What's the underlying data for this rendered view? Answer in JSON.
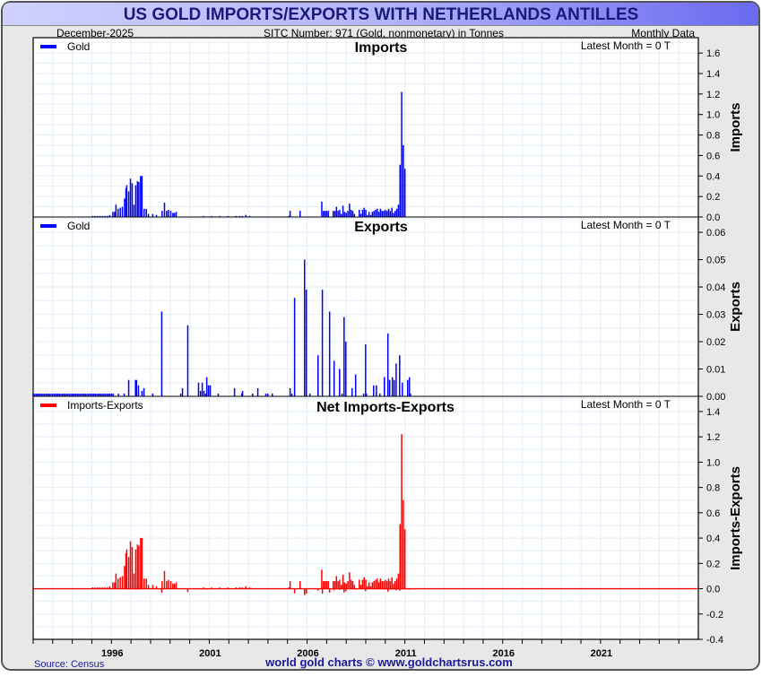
{
  "header": {
    "title": "US GOLD IMPORTS/EXPORTS WITH NETHERLANDS ANTILLES",
    "date": "December-2025",
    "subtitle": "SITC Number: 971 (Gold, nonmonetary) in Tonnes",
    "frequency": "Monthly Data"
  },
  "footer": {
    "source": "Source: Census",
    "credit": "world gold charts © www.goldchartsrus.com"
  },
  "colors": {
    "imports": "#0000ff",
    "exports": "#0000ff",
    "net": "#ff0000",
    "title_text": "#1a1a7a",
    "grid": "#e3eef8"
  },
  "chart_data": [
    {
      "type": "bar",
      "title": "Imports",
      "ylabel": "Imports",
      "legend": "Gold",
      "latest": "Latest Month = 0 T",
      "xlim": [
        1992,
        2026
      ],
      "ylim": [
        0,
        1.75
      ],
      "yticks": [
        "0.0",
        "0.2",
        "0.4",
        "0.6",
        "0.8",
        "1.0",
        "1.2",
        "1.4",
        "1.6"
      ],
      "points": [
        [
          1995.04,
          0.01
        ],
        [
          1995.16,
          0.01
        ],
        [
          1995.29,
          0.01
        ],
        [
          1995.41,
          0.01
        ],
        [
          1995.54,
          0.01
        ],
        [
          1995.66,
          0.01
        ],
        [
          1995.79,
          0.01
        ],
        [
          1995.91,
          0.02
        ],
        [
          1996.07,
          0.05
        ],
        [
          1996.16,
          0.05
        ],
        [
          1996.23,
          0.12
        ],
        [
          1996.34,
          0.08
        ],
        [
          1996.45,
          0.09
        ],
        [
          1996.56,
          0.1
        ],
        [
          1996.67,
          0.18
        ],
        [
          1996.74,
          0.28
        ],
        [
          1996.78,
          0.31
        ],
        [
          1996.88,
          0.25
        ],
        [
          1996.97,
          0.375
        ],
        [
          1997.06,
          0.33
        ],
        [
          1997.15,
          0.12
        ],
        [
          1997.24,
          0.31
        ],
        [
          1997.33,
          0.35
        ],
        [
          1997.4,
          0.34
        ],
        [
          1997.49,
          0.4
        ],
        [
          1997.56,
          0.4
        ],
        [
          1997.67,
          0.08
        ],
        [
          1997.78,
          0.08
        ],
        [
          1997.89,
          0.03
        ],
        [
          1998.11,
          0.03
        ],
        [
          1998.3,
          0.02
        ],
        [
          1998.59,
          0.06
        ],
        [
          1998.71,
          0.14
        ],
        [
          1998.82,
          0.06
        ],
        [
          1998.91,
          0.07
        ],
        [
          1999.03,
          0.06
        ],
        [
          1999.14,
          0.04
        ],
        [
          1999.22,
          0.04
        ],
        [
          1999.31,
          0.05
        ],
        [
          2000.72,
          0.01
        ],
        [
          2001.13,
          0.01
        ],
        [
          2001.54,
          0.01
        ],
        [
          2001.96,
          0.01
        ],
        [
          2002.37,
          0.01
        ],
        [
          2002.56,
          0.01
        ],
        [
          2002.69,
          0.01
        ],
        [
          2002.87,
          0.02
        ],
        [
          2003.06,
          0.01
        ],
        [
          2005.06,
          0.01
        ],
        [
          2005.13,
          0.06
        ],
        [
          2005.64,
          0.06
        ]
      ],
      "monthly_block": {
        "start": 2006.75,
        "values": [
          0.15,
          0.06,
          0.06,
          0.06,
          0.06,
          0,
          0,
          0.06,
          0.06,
          0.1,
          0.06,
          0.07,
          0.03,
          0.11,
          0.05,
          0.04,
          0.06,
          0.13,
          0.07,
          0.06,
          0.03,
          0,
          0,
          0.07,
          0.03,
          0.07,
          0.09,
          0.07,
          0.02,
          0.05,
          0.02,
          0.05,
          0.06,
          0.07,
          0.08,
          0.05,
          0.08,
          0.06,
          0.06,
          0.07,
          0.06,
          0.08,
          0.06,
          0.09,
          0.04,
          0.06,
          0.08,
          0.12,
          0.51,
          1.22,
          0.7,
          0.47
        ]
      }
    },
    {
      "type": "bar",
      "title": "Exports",
      "ylabel": "Exports",
      "legend": "Gold",
      "latest": "Latest Month = 0 T",
      "xlim": [
        1992,
        2026
      ],
      "ylim": [
        0,
        0.0656
      ],
      "yticks": [
        "0.00",
        "0.01",
        "0.02",
        "0.03",
        "0.04",
        "0.05",
        "0.06"
      ],
      "points": [
        [
          1996.36,
          0.001
        ],
        [
          1996.65,
          0.001
        ],
        [
          1996.88,
          0.006
        ],
        [
          1997.23,
          0.006
        ],
        [
          1997.28,
          0.006
        ],
        [
          1997.38,
          0.004
        ],
        [
          1997.56,
          0.002
        ],
        [
          1997.66,
          0.003
        ],
        [
          1998.11,
          0.001
        ],
        [
          1998.57,
          0.031
        ],
        [
          1999.54,
          0.001
        ],
        [
          1999.63,
          0.003
        ],
        [
          1999.9,
          0.026
        ],
        [
          2000.45,
          0.005
        ],
        [
          2000.55,
          0.002
        ],
        [
          2000.64,
          0.005
        ],
        [
          2000.73,
          0.002
        ],
        [
          2000.82,
          0.001
        ],
        [
          2000.87,
          0.007
        ],
        [
          2000.96,
          0.004
        ],
        [
          2001.05,
          0.004
        ],
        [
          2001.46,
          0.001
        ],
        [
          2002.29,
          0.003
        ],
        [
          2002.66,
          0.001
        ],
        [
          2002.7,
          0.002
        ],
        [
          2003.21,
          0.001
        ],
        [
          2003.48,
          0.003
        ],
        [
          2003.89,
          0.001
        ],
        [
          2003.99,
          0.001
        ],
        [
          2004.22,
          0.001
        ],
        [
          2005.13,
          0.003
        ],
        [
          2005.22,
          0.001
        ],
        [
          2005.36,
          0.036
        ],
        [
          2005.87,
          0.05
        ],
        [
          2005.96,
          0.039
        ],
        [
          2006.14,
          0.001
        ],
        [
          2006.56,
          0.015
        ],
        [
          2006.78,
          0.039
        ],
        [
          2007.15,
          0.031
        ],
        [
          2007.38,
          0.013
        ],
        [
          2007.66,
          0.01
        ],
        [
          2007.79,
          0.001
        ],
        [
          2007.89,
          0.029
        ],
        [
          2007.98,
          0.02
        ],
        [
          2008.3,
          0.003
        ],
        [
          2008.48,
          0.008
        ],
        [
          2008.89,
          0.001
        ],
        [
          2008.99,
          0.019
        ],
        [
          2009.03,
          0.001
        ],
        [
          2009.4,
          0.004
        ],
        [
          2009.54,
          0.004
        ],
        [
          2009.72,
          0.001
        ],
        [
          2009.95,
          0.007
        ],
        [
          2010.13,
          0.023
        ],
        [
          2010.22,
          0.006
        ],
        [
          2010.36,
          0.007
        ],
        [
          2010.45,
          0.006
        ],
        [
          2010.55,
          0.012
        ],
        [
          2010.73,
          0.015
        ],
        [
          2010.87,
          0.005
        ],
        [
          2011.14,
          0.006
        ],
        [
          2011.23,
          0.007
        ],
        [
          2011.28,
          0.001
        ]
      ],
      "monthly_block": {
        "start": 1992.0,
        "values": [
          0.001,
          0.001,
          0.001,
          0.001,
          0.001,
          0.001,
          0.001,
          0.001,
          0.001,
          0.001,
          0.001,
          0.001,
          0.001,
          0.001,
          0.001,
          0.001,
          0.001,
          0.001,
          0.001,
          0.001,
          0.001,
          0.001,
          0.001,
          0.001,
          0.001,
          0.001,
          0.001,
          0.001,
          0.001,
          0.001,
          0.001,
          0.001,
          0.001,
          0.001,
          0.001,
          0.001,
          0.001,
          0.001,
          0.001,
          0.001,
          0.001,
          0.001,
          0.001,
          0.001,
          0.001,
          0.001,
          0.001,
          0.001,
          0.001,
          0.001
        ]
      }
    },
    {
      "type": "bar",
      "title": "Net Imports-Exports",
      "ylabel": "Imports-Exports",
      "legend": "Imports-Exports",
      "latest": "Latest Month = 0 T",
      "xlim": [
        1992,
        2026
      ],
      "ylim": [
        -0.4,
        1.52
      ],
      "yticks": [
        "-0.4",
        "-0.2",
        "0.0",
        "0.2",
        "0.4",
        "0.6",
        "0.8",
        "1.0",
        "1.2",
        "1.4"
      ]
    }
  ],
  "xaxis": {
    "labels": [
      "1996",
      "2001",
      "2006",
      "2011",
      "2016",
      "2021"
    ]
  }
}
